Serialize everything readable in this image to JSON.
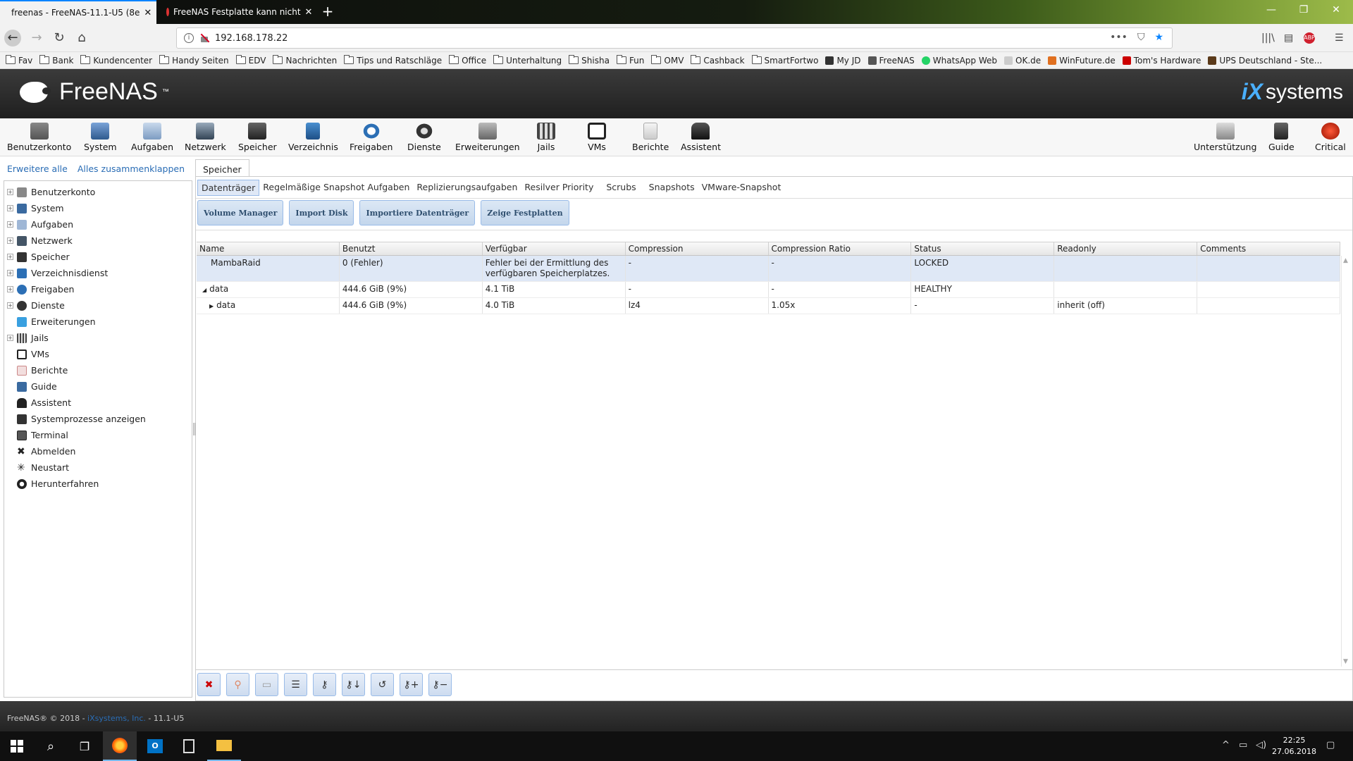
{
  "browser": {
    "tabs": [
      {
        "label": "freenas - FreeNAS-11.1-U5 (8e"
      },
      {
        "label": "FreeNAS Festplatte kann nicht"
      }
    ],
    "url": "192.168.178.22",
    "bookmarks": [
      "Fav",
      "Bank",
      "Kundencenter",
      "Handy Seiten",
      "EDV",
      "Nachrichten",
      "Tips und Ratschläge",
      "Office",
      "Unterhaltung",
      "Shisha",
      "Fun",
      "OMV",
      "Cashback",
      "SmartFortwo",
      "My JD",
      "FreeNAS",
      "WhatsApp Web",
      "OK.de",
      "WinFuture.de",
      "Tom's Hardware",
      "UPS Deutschland - Ste..."
    ]
  },
  "header": {
    "brand": "FreeNAS",
    "brand_tm": "™",
    "vendor_ix": "iX",
    "vendor_systems": "systems"
  },
  "toolbar": {
    "items": [
      "Benutzerkonto",
      "System",
      "Aufgaben",
      "Netzwerk",
      "Speicher",
      "Verzeichnis",
      "Freigaben",
      "Dienste",
      "Erweiterungen",
      "Jails",
      "VMs",
      "Berichte",
      "Assistent"
    ],
    "right_items": [
      "Unterstützung",
      "Guide",
      "Critical"
    ]
  },
  "sidebar": {
    "expand_all": "Erweitere alle",
    "collapse_all": "Alles zusammenklappen",
    "items": [
      "Benutzerkonto",
      "System",
      "Aufgaben",
      "Netzwerk",
      "Speicher",
      "Verzeichnisdienst",
      "Freigaben",
      "Dienste",
      "Erweiterungen",
      "Jails",
      "VMs",
      "Berichte",
      "Guide",
      "Assistent",
      "Systemprozesse anzeigen",
      "Terminal",
      "Abmelden",
      "Neustart",
      "Herunterfahren"
    ]
  },
  "main": {
    "tab": "Speicher",
    "subtabs": [
      "Datenträger",
      "Regelmäßige Snapshot Aufgaben",
      "Replizierungsaufgaben",
      "Resilver Priority",
      "Scrubs",
      "Snapshots",
      "VMware-Snapshot"
    ],
    "buttons": [
      "Volume Manager",
      "Import Disk",
      "Importiere Datenträger",
      "Zeige Festplatten"
    ],
    "columns": [
      "Name",
      "Benutzt",
      "Verfügbar",
      "Compression",
      "Compression Ratio",
      "Status",
      "Readonly",
      "Comments"
    ],
    "rows": [
      {
        "name": "MambaRaid",
        "used": "0 (Fehler)",
        "avail": "Fehler bei der Ermittlung des verfügbaren Speicherplatzes.",
        "compression": "-",
        "ratio": "-",
        "status": "LOCKED",
        "readonly": "",
        "comments": ""
      },
      {
        "name": "data",
        "used": "444.6 GiB (9%)",
        "avail": "4.1 TiB",
        "compression": "-",
        "ratio": "-",
        "status": "HEALTHY",
        "readonly": "",
        "comments": ""
      },
      {
        "name": "data",
        "used": "444.6 GiB (9%)",
        "avail": "4.0 TiB",
        "compression": "lz4",
        "ratio": "1.05x",
        "status": "-",
        "readonly": "inherit (off)",
        "comments": ""
      }
    ]
  },
  "footer": {
    "text": "FreeNAS® © 2018 - ",
    "link": "iXsystems, Inc.",
    "version": " - 11.1-U5"
  },
  "taskbar": {
    "time": "22:25",
    "date": "27.06.2018"
  }
}
